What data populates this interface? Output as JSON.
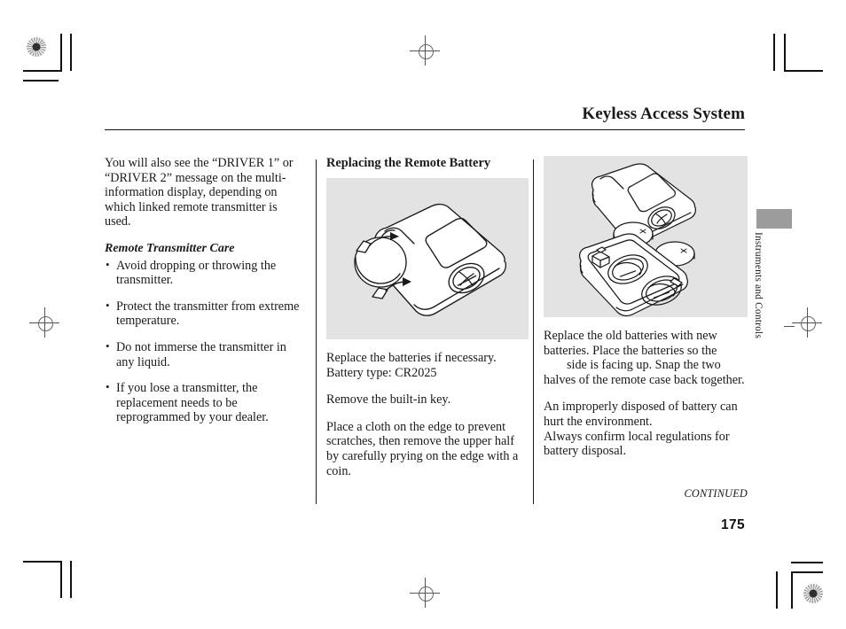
{
  "page": {
    "title": "Keyless Access System",
    "folio": "175",
    "continued": "CONTINUED",
    "side_tab_label": "Instruments and Controls"
  },
  "left_column": {
    "intro": "You will also see the “DRIVER 1” or “DRIVER 2” message on the multi-information display, depending on which linked remote transmitter is used.",
    "care_heading": "Remote Transmitter Care",
    "care_bullets": [
      "Avoid dropping or throwing the transmitter.",
      "Protect the transmitter from extreme temperature.",
      "Do not immerse the transmitter in any liquid.",
      "If you lose a transmitter, the replacement needs to be reprogrammed by your dealer."
    ]
  },
  "middle_column": {
    "heading": "Replacing the Remote Battery",
    "figure_caption": "remote transmitter with coin prying open the case",
    "paragraphs": [
      "Replace the batteries if necessary.\nBattery type: CR2025",
      "Remove the built-in key.",
      "Place a cloth on the edge to prevent scratches, then remove the upper half by carefully prying on the edge with a coin."
    ]
  },
  "right_column": {
    "figure_caption": "exploded view of remote case halves with two coin batteries",
    "paragraph_1_line_1": "Replace the old batteries with new",
    "paragraph_1_line_2": "batteries. Place the batteries so the",
    "paragraph_1_line_3": "side is facing up. Snap the two",
    "paragraph_1_line_4": "halves of the remote case back",
    "paragraph_1_line_5": "together.",
    "paragraph_2": "An improperly disposed of battery can hurt the environment.\nAlways confirm local regulations for battery disposal."
  },
  "colors": {
    "figure_background": "#e3e3e3",
    "tab_gray": "#9c9c9c",
    "ink": "#1a1a1a"
  }
}
